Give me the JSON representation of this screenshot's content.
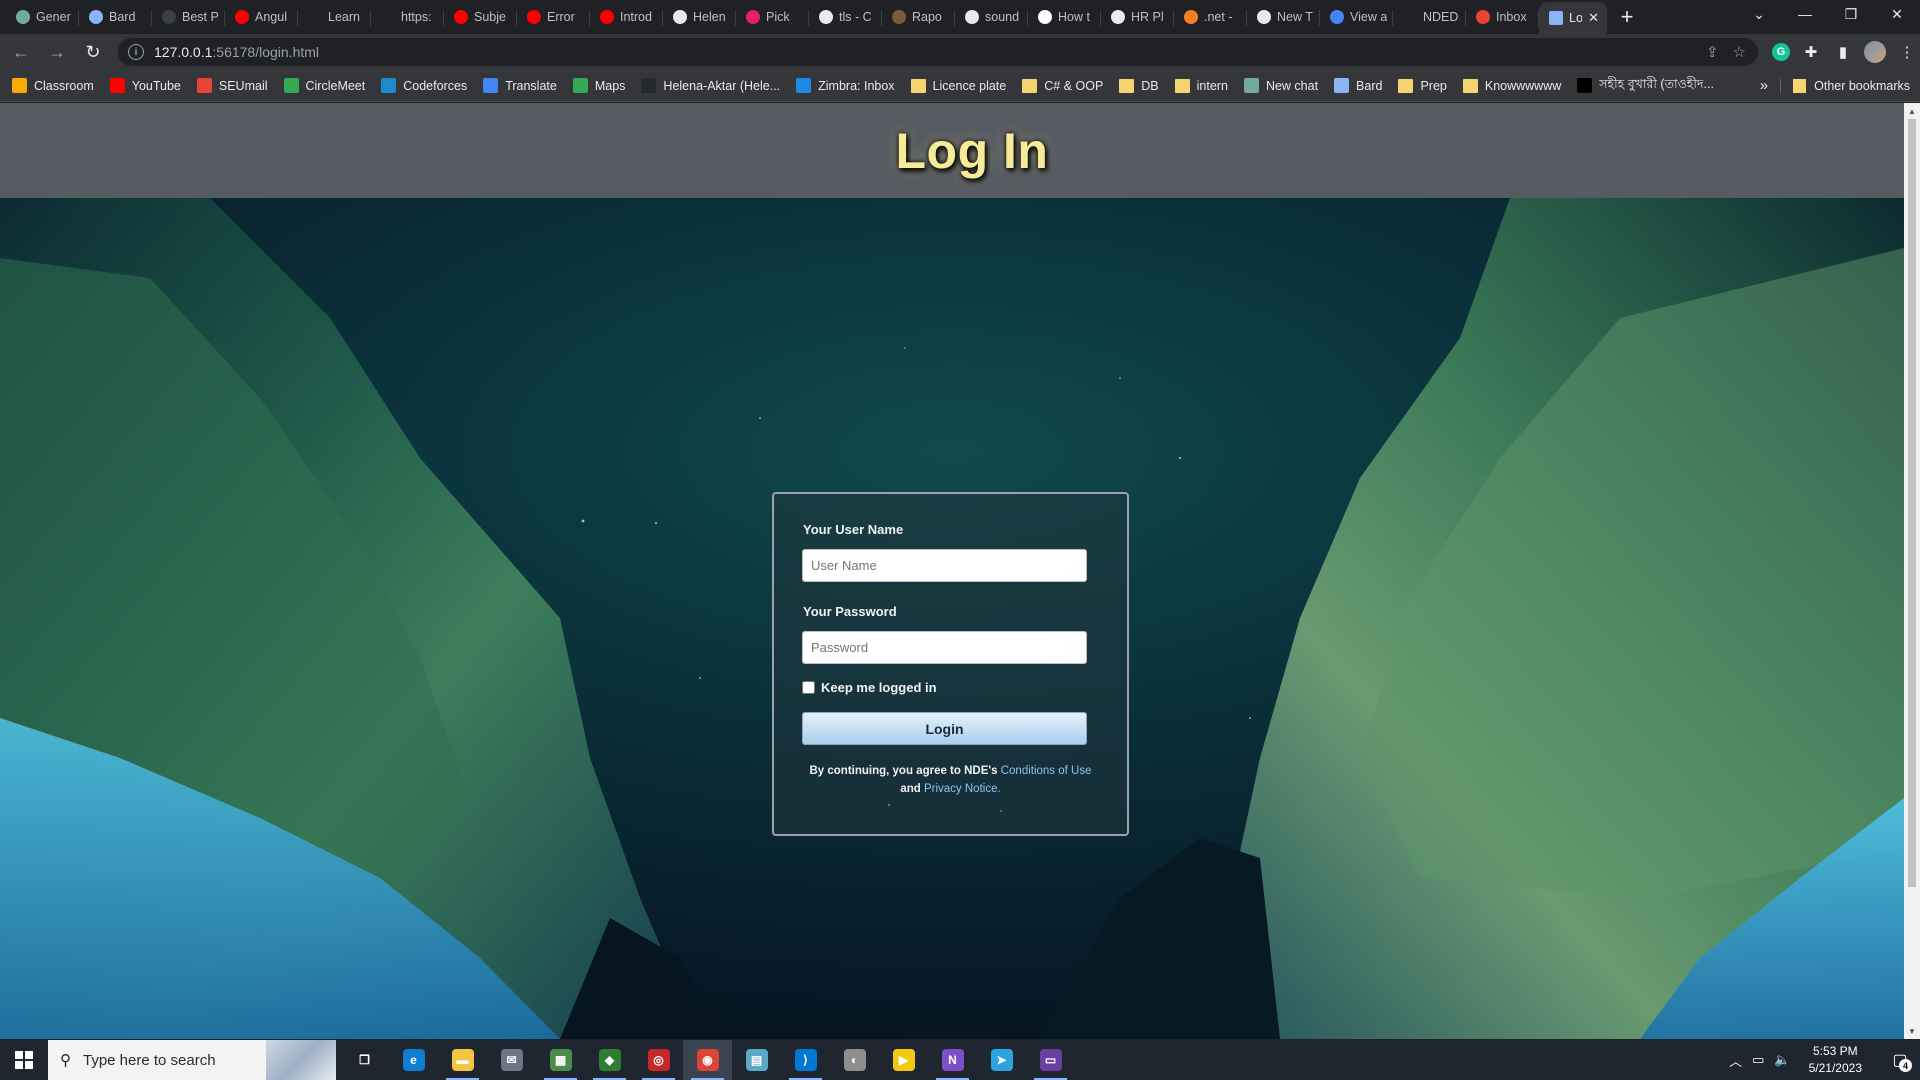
{
  "tabs": [
    {
      "label": "Gener",
      "color": "#74aa9c"
    },
    {
      "label": "Bard",
      "color": "#8ab4f8"
    },
    {
      "label": "Best P",
      "color": "#3c4043"
    },
    {
      "label": "Angul",
      "color": "#ff0000"
    },
    {
      "label": "Learn",
      "color": "#202124"
    },
    {
      "label": "https:",
      "color": "#202124"
    },
    {
      "label": "Subje",
      "color": "#ff0000"
    },
    {
      "label": "Error",
      "color": "#ff0000"
    },
    {
      "label": "Introd",
      "color": "#ff0000"
    },
    {
      "label": "Helen",
      "color": "#e8eaed"
    },
    {
      "label": "Pick",
      "color": "#e91e63"
    },
    {
      "label": "tls - C",
      "color": "#e8eaed"
    },
    {
      "label": "Rapo",
      "color": "#7a5c3c"
    },
    {
      "label": "sound",
      "color": "#e8eaed"
    },
    {
      "label": "How t",
      "color": "#ffffff"
    },
    {
      "label": "HR Pl",
      "color": "#e8eaed"
    },
    {
      "label": ".net -",
      "color": "#f48024"
    },
    {
      "label": "New T",
      "color": "#e8eaed"
    },
    {
      "label": "View a",
      "color": "#4285f4"
    },
    {
      "label": "NDED",
      "color": "#202124"
    },
    {
      "label": "Inbox",
      "color": "#ea4335"
    }
  ],
  "active_tab": {
    "label": "Lo",
    "close": "✕"
  },
  "new_tab_symbol": "+",
  "window_controls": [
    "⌄",
    "—",
    "❐",
    "✕"
  ],
  "address": {
    "host": "127.0.0.1",
    "path": ":56178/login.html"
  },
  "bookmarks": [
    {
      "label": "Classroom",
      "color": "#f9ab00"
    },
    {
      "label": "YouTube",
      "color": "#ff0000"
    },
    {
      "label": "SEUmail",
      "color": "#ea4335"
    },
    {
      "label": "CircleMeet",
      "color": "#34a853"
    },
    {
      "label": "Codeforces",
      "color": "#1f8acb"
    },
    {
      "label": "Translate",
      "color": "#4285f4"
    },
    {
      "label": "Maps",
      "color": "#34a853"
    },
    {
      "label": "Helena-Aktar (Hele...",
      "color": "#24292e"
    },
    {
      "label": "Zimbra: Inbox",
      "color": "#1e88e5"
    },
    {
      "label": "Licence plate",
      "color": "folder"
    },
    {
      "label": "C# & OOP",
      "color": "folder"
    },
    {
      "label": "DB",
      "color": "folder"
    },
    {
      "label": "intern",
      "color": "folder"
    },
    {
      "label": "New chat",
      "color": "#74aa9c"
    },
    {
      "label": "Bard",
      "color": "#8ab4f8"
    },
    {
      "label": "Prep",
      "color": "folder"
    },
    {
      "label": "Knowwwwww",
      "color": "folder"
    },
    {
      "label": "সহীহ বুখারী (তাওহীদ...",
      "color": "#000000"
    }
  ],
  "bookmarks_overflow": "»",
  "other_bookmarks": "Other bookmarks",
  "page": {
    "heading": "Log In",
    "username_label": "Your User Name",
    "username_placeholder": "User Name",
    "password_label": "Your Password",
    "password_placeholder": "Password",
    "keep_logged_in": "Keep me logged in",
    "login_button": "Login",
    "terms_prefix": "By continuing, you agree to NDE's ",
    "terms_link1": "Conditions of Use",
    "terms_and": "and ",
    "terms_link2": "Privacy Notice."
  },
  "taskbar": {
    "search_placeholder": "Type here to search",
    "apps": [
      {
        "name": "task-view",
        "glyph": "❐",
        "color": "transparent"
      },
      {
        "name": "edge",
        "glyph": "e",
        "color": "#0f7dd1"
      },
      {
        "name": "file-explorer",
        "glyph": "▬",
        "color": "#f4c542"
      },
      {
        "name": "mail",
        "glyph": "✉",
        "color": "#6b7785"
      },
      {
        "name": "app-5",
        "glyph": "▦",
        "color": "#4c8c4a"
      },
      {
        "name": "app-6",
        "glyph": "◆",
        "color": "#2e7d32"
      },
      {
        "name": "app-7",
        "glyph": "◎",
        "color": "#c62828"
      },
      {
        "name": "chrome",
        "glyph": "◉",
        "color": "#db4437"
      },
      {
        "name": "notepad",
        "glyph": "▤",
        "color": "#5aa9c9"
      },
      {
        "name": "vscode",
        "glyph": "⟩",
        "color": "#0078d4"
      },
      {
        "name": "app-11",
        "glyph": "◐",
        "color": "#8e8e8e"
      },
      {
        "name": "player",
        "glyph": "▶",
        "color": "#f2c811"
      },
      {
        "name": "visual-studio",
        "glyph": "N",
        "color": "#7f4fc9"
      },
      {
        "name": "telegram",
        "glyph": "➤",
        "color": "#2aa3e0"
      },
      {
        "name": "terminal",
        "glyph": "▭",
        "color": "#6a3fa0"
      }
    ],
    "time": "5:53 PM",
    "date": "5/21/2023",
    "notifications": "4"
  }
}
